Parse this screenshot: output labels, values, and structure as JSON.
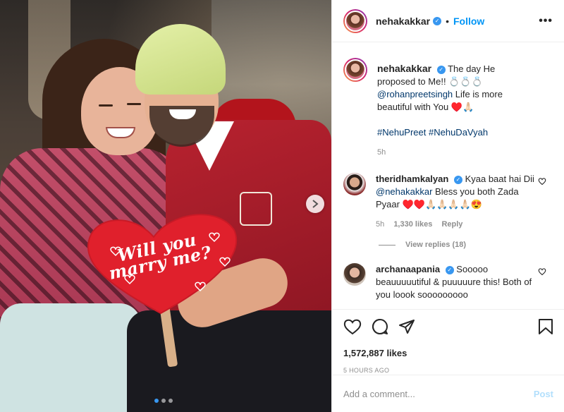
{
  "post": {
    "photo_heart_text": "Will you marry me?",
    "carousel": {
      "total": 3,
      "active": 0
    }
  },
  "header": {
    "username": "nehakakkar",
    "separator": "•",
    "follow_label": "Follow",
    "more_label": "•••"
  },
  "caption": {
    "username": "nehakakkar",
    "text_1": "The day He proposed to Me!! 💍💍💍",
    "mention": "@rohanpreetsingh",
    "text_2": "Life is more beautiful with You ♥️🙏🏻",
    "hashtags": "#NehuPreet #NehuDaVyah",
    "time": "5h"
  },
  "comments": [
    {
      "username": "theridhamkalyan",
      "text_1": "Kyaa baat hai Dii",
      "mention": "@nehakakkar",
      "text_2": "Bless you both Zada Pyaar ♥️♥️🙏🏻🙏🏻🙏🏻🙏🏻😍",
      "time": "5h",
      "likes": "1,330 likes",
      "reply": "Reply",
      "view_replies": "View replies (18)"
    },
    {
      "username": "archanaapania",
      "text": "Sooooo beauuuuutiful & puuuuure this! Both of you loook sooooooooo"
    }
  ],
  "actions": {
    "likes": "1,572,887 likes",
    "date": "5 HOURS AGO"
  },
  "add_comment": {
    "placeholder": "Add a comment...",
    "post_label": "Post"
  },
  "colors": {
    "accent": "#0095f6",
    "verified": "#3897f0",
    "link": "#00376b",
    "muted": "#8e8e8e",
    "shirt": "#b8222f",
    "heart_sign": "#e0202c"
  },
  "icons": [
    "verified-badge-icon",
    "more-options-icon",
    "heart-icon",
    "comment-icon",
    "share-icon",
    "bookmark-icon",
    "chevron-right-icon"
  ]
}
